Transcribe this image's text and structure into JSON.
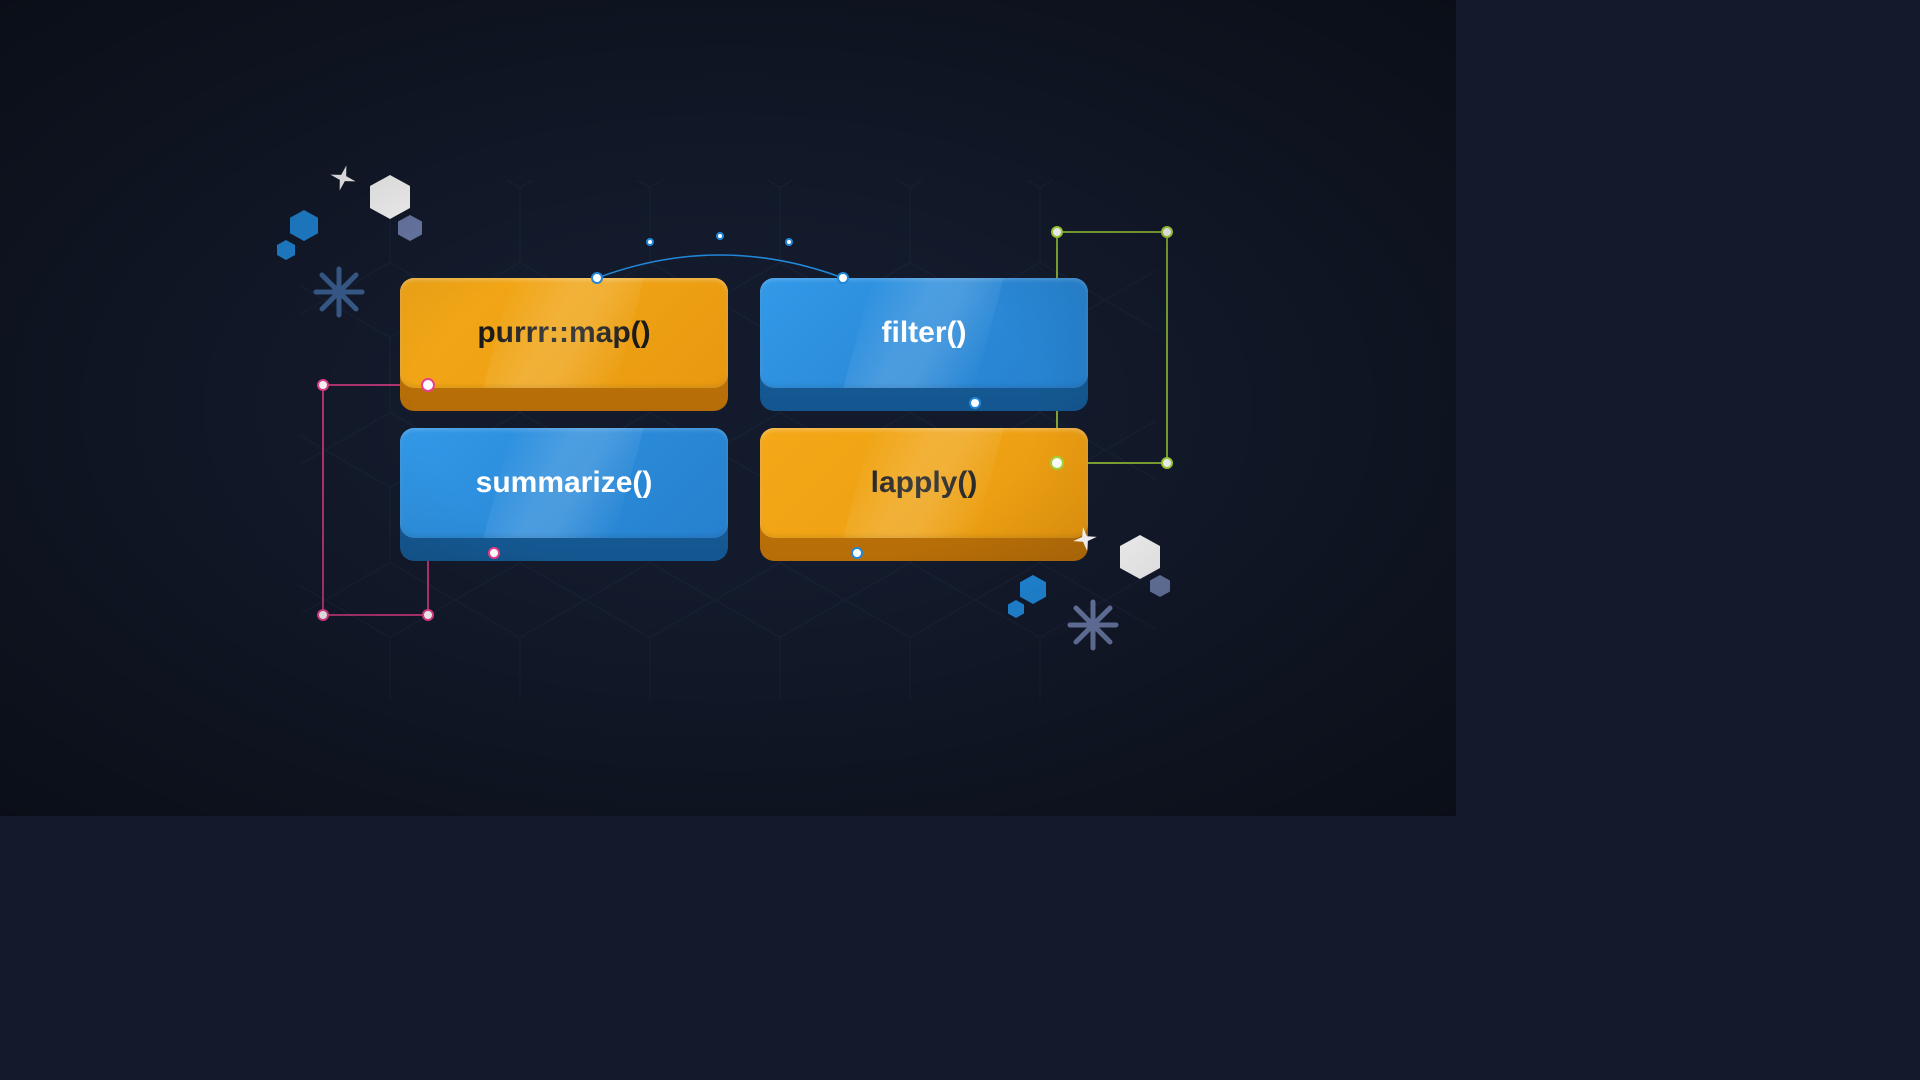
{
  "cards": {
    "top_left": "purrr::map()",
    "top_right": "filter()",
    "bottom_left": "summarize()",
    "bottom_right": "lapply()"
  },
  "colors": {
    "orange": "#efa314",
    "blue": "#2b8bda",
    "pink": "#e83e8c",
    "green": "#a4d437",
    "cyan": "#3299e8",
    "white": "#ffffff",
    "pale_blue": "#6b7ba8",
    "bright_blue": "#2188d9"
  }
}
